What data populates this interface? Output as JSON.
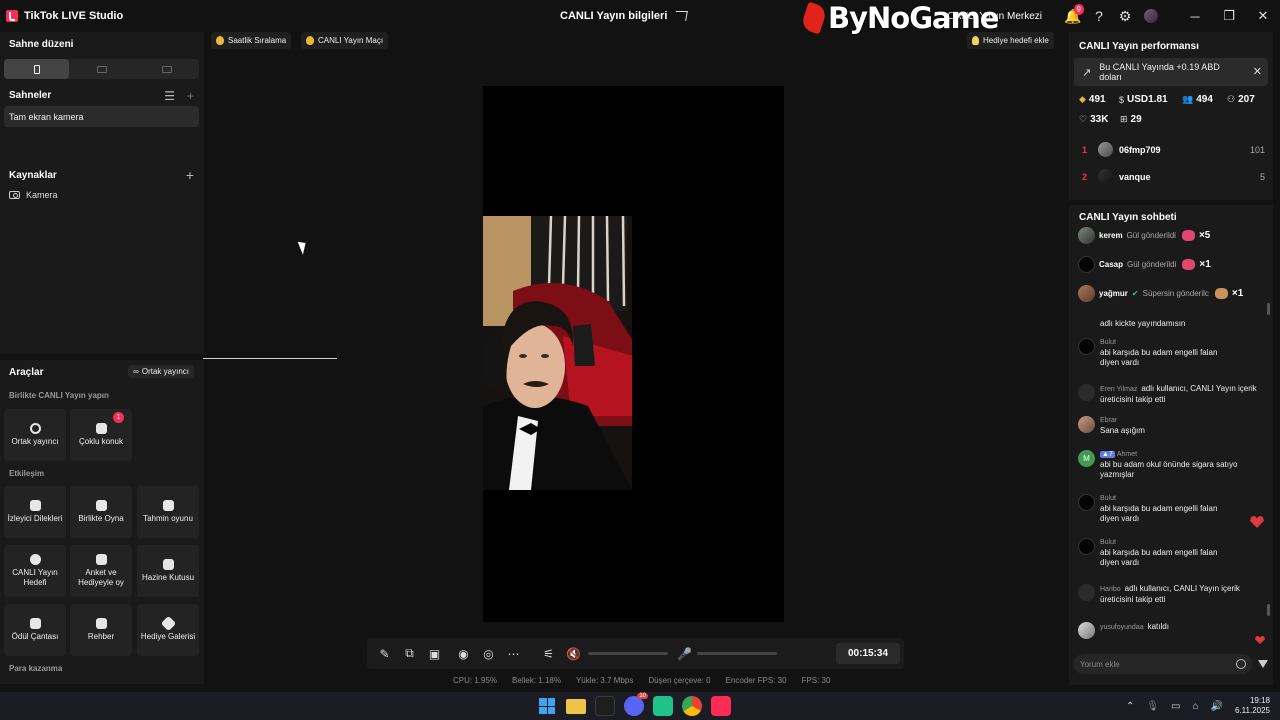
{
  "titlebar": {
    "app_title": "TikTok LIVE Studio",
    "stream_info_title": "CANLI Yayın bilgileri",
    "watermark": "ByNoGame",
    "live_center": "CANLI Yayın Merkezi",
    "notification_count": "9"
  },
  "left": {
    "scene_layout_title": "Sahne düzeni",
    "scenes_title": "Sahneler",
    "scene_item": "Tam ekran kamera",
    "sources_title": "Kaynaklar",
    "source_item": "Kamera"
  },
  "tools": {
    "title": "Araçlar",
    "co_host_link": "Ortak yayıncı",
    "section_together": "Birlikte CANLI Yayın yapın",
    "section_interaction": "Etkileşim",
    "section_monetize": "Para kazanma",
    "items": [
      {
        "label": "Ortak yayıncı"
      },
      {
        "label": "Çoklu konuk",
        "badge": "1"
      },
      {
        "label": "İzleyici Dilekleri"
      },
      {
        "label": "Birlikte Oyna"
      },
      {
        "label": "Tahmin oyunu"
      },
      {
        "label": "CANLI Yayın Hedefi"
      },
      {
        "label": "Anket ve Hediyeyle oy"
      },
      {
        "label": "Hazine Kutusu"
      },
      {
        "label": "Ödül Çantası"
      },
      {
        "label": "Rehber"
      },
      {
        "label": "Hediye Galerisi"
      }
    ]
  },
  "center": {
    "pill_ranking": "Saatlik Sıralama",
    "pill_match": "CANLI Yayın Maçı",
    "pill_gift_goal": "Hediye hedefi ekle",
    "timer": "00:15:34"
  },
  "stats": {
    "cpu": "CPU: 1.95%",
    "memory": "Bellek: 1.18%",
    "upload": "Yükle: 3.7 Mbps",
    "dropped": "Düşen çerçeve: 0",
    "encoder_fps": "Encoder FPS: 30",
    "fps": "FPS: 30"
  },
  "performance": {
    "title": "CANLI Yayın performansı",
    "earn_banner": "Bu CANLI Yayında +0.19 ABD doları",
    "diamonds": "491",
    "usd": "USD1.81",
    "viewers": "494",
    "new_followers": "207",
    "likes": "33K",
    "gifters": "29",
    "ranking": [
      {
        "rank": "1",
        "name": "06fmp709",
        "score": "101"
      },
      {
        "rank": "2",
        "name": "vanque",
        "score": "5"
      }
    ]
  },
  "chat": {
    "title": "CANLI Yayın sohbeti",
    "gifts": [
      {
        "name": "kerem",
        "action": "Gül gönderildi",
        "count": "×5"
      },
      {
        "name": "Casap",
        "action": "Gül gönderildi",
        "count": "×1"
      },
      {
        "name": "yağmur",
        "action": "Süpersin gönderilc",
        "count": "×1"
      }
    ],
    "messages": [
      {
        "user": "",
        "text": "adlı kickte yayındamısın"
      },
      {
        "user": "Bulut",
        "text": "abi karşıda bu adam engelli falan diyen vardı"
      },
      {
        "user": "Eren Yilmaz",
        "text": "adlı kullanıcı, CANLI Yayın içerik üreticisini takip etti"
      },
      {
        "user": "Ebrar",
        "text": "Sana aşığım"
      },
      {
        "user": "Ahmet",
        "level": "7",
        "text": "abi bu adam okul önünde sigara satıyo yazmışlar"
      },
      {
        "user": "Bulut",
        "text": "abi karşıda bu adam engelli falan diyen vardı"
      },
      {
        "user": "Bulut",
        "text": "abi karşıda bu adam engelli falan diyen vardı"
      },
      {
        "user": "Haribo",
        "text": "adlı kullanıcı, CANLI Yayın içerik üreticisini takip etti"
      },
      {
        "user": "yusufoyundaa",
        "text": "katıldı"
      }
    ],
    "comment_placeholder": "Yorum ekle"
  },
  "taskbar": {
    "time": "19:18",
    "date": "6.11.2025",
    "discord_badge": "10"
  }
}
